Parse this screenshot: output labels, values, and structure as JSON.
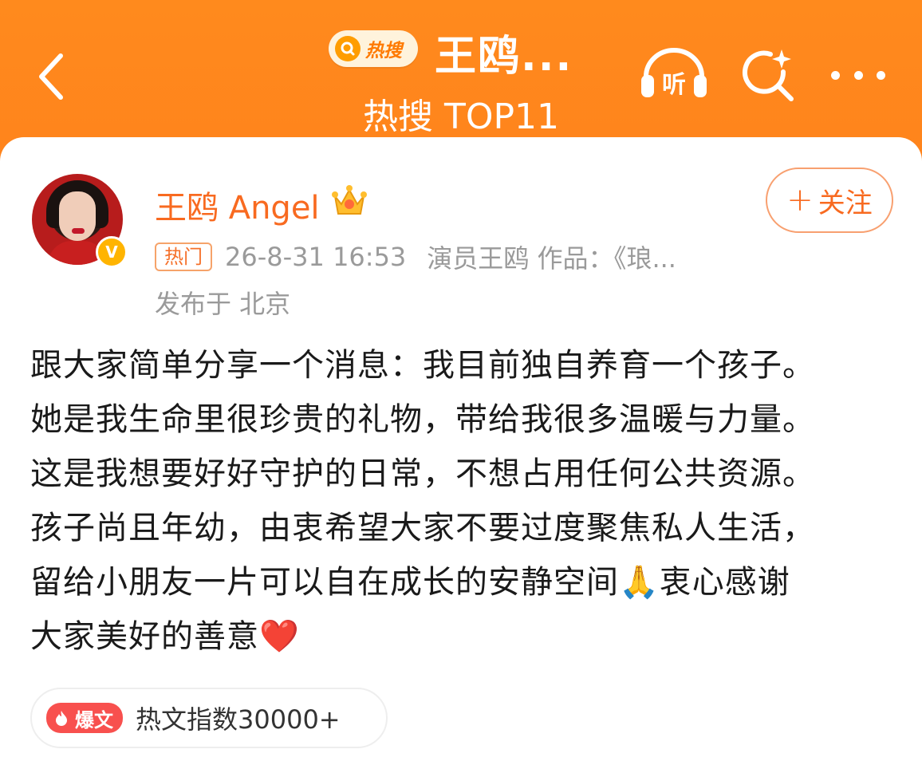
{
  "header": {
    "badge_label": "热搜",
    "title": "王鸥...",
    "subtitle": "热搜 TOP11",
    "listen_label": "听"
  },
  "post": {
    "author": "王鸥 Angel",
    "verified_mark": "V",
    "follow_plus": "+",
    "follow_label": "关注",
    "hot_tag": "热门",
    "timestamp": "26-8-31 16:53",
    "source": "演员王鸥 作品：《琅...",
    "location": "发布于 北京",
    "lines": [
      "跟大家简单分享一个消息：我目前独自养育一个孩子。",
      "她是我生命里很珍贵的礼物，带给我很多温暖与力量。",
      "这是我想要好好守护的日常，不想占用任何公共资源。",
      "孩子尚且年幼，由衷希望大家不要过度聚焦私人生活，",
      "留给小朋友一片可以自在成长的安静空间🙏衷心感谢",
      "大家美好的善意❤️"
    ],
    "stat_badge": "爆文",
    "stat_text": "热文指数30000+"
  },
  "colors": {
    "header_bg": "#ff7a1d",
    "accent": "#f86a20",
    "badge_red": "#f8504e",
    "meta_gray": "#9a9a9a"
  },
  "icons": [
    "back-icon",
    "search-badge-icon",
    "headphones-icon",
    "search-sparkle-icon",
    "more-icon",
    "crown-icon",
    "flame-icon"
  ]
}
